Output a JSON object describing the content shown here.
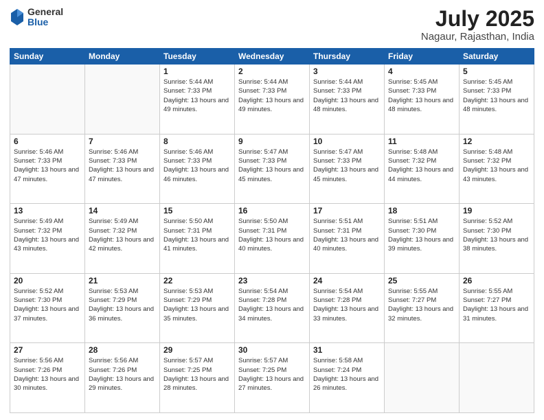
{
  "logo": {
    "general": "General",
    "blue": "Blue"
  },
  "title": "July 2025",
  "location": "Nagaur, Rajasthan, India",
  "days_of_week": [
    "Sunday",
    "Monday",
    "Tuesday",
    "Wednesday",
    "Thursday",
    "Friday",
    "Saturday"
  ],
  "weeks": [
    [
      {
        "day": "",
        "info": ""
      },
      {
        "day": "",
        "info": ""
      },
      {
        "day": "1",
        "info": "Sunrise: 5:44 AM\nSunset: 7:33 PM\nDaylight: 13 hours\nand 49 minutes."
      },
      {
        "day": "2",
        "info": "Sunrise: 5:44 AM\nSunset: 7:33 PM\nDaylight: 13 hours\nand 49 minutes."
      },
      {
        "day": "3",
        "info": "Sunrise: 5:44 AM\nSunset: 7:33 PM\nDaylight: 13 hours\nand 48 minutes."
      },
      {
        "day": "4",
        "info": "Sunrise: 5:45 AM\nSunset: 7:33 PM\nDaylight: 13 hours\nand 48 minutes."
      },
      {
        "day": "5",
        "info": "Sunrise: 5:45 AM\nSunset: 7:33 PM\nDaylight: 13 hours\nand 48 minutes."
      }
    ],
    [
      {
        "day": "6",
        "info": "Sunrise: 5:46 AM\nSunset: 7:33 PM\nDaylight: 13 hours\nand 47 minutes."
      },
      {
        "day": "7",
        "info": "Sunrise: 5:46 AM\nSunset: 7:33 PM\nDaylight: 13 hours\nand 47 minutes."
      },
      {
        "day": "8",
        "info": "Sunrise: 5:46 AM\nSunset: 7:33 PM\nDaylight: 13 hours\nand 46 minutes."
      },
      {
        "day": "9",
        "info": "Sunrise: 5:47 AM\nSunset: 7:33 PM\nDaylight: 13 hours\nand 45 minutes."
      },
      {
        "day": "10",
        "info": "Sunrise: 5:47 AM\nSunset: 7:33 PM\nDaylight: 13 hours\nand 45 minutes."
      },
      {
        "day": "11",
        "info": "Sunrise: 5:48 AM\nSunset: 7:32 PM\nDaylight: 13 hours\nand 44 minutes."
      },
      {
        "day": "12",
        "info": "Sunrise: 5:48 AM\nSunset: 7:32 PM\nDaylight: 13 hours\nand 43 minutes."
      }
    ],
    [
      {
        "day": "13",
        "info": "Sunrise: 5:49 AM\nSunset: 7:32 PM\nDaylight: 13 hours\nand 43 minutes."
      },
      {
        "day": "14",
        "info": "Sunrise: 5:49 AM\nSunset: 7:32 PM\nDaylight: 13 hours\nand 42 minutes."
      },
      {
        "day": "15",
        "info": "Sunrise: 5:50 AM\nSunset: 7:31 PM\nDaylight: 13 hours\nand 41 minutes."
      },
      {
        "day": "16",
        "info": "Sunrise: 5:50 AM\nSunset: 7:31 PM\nDaylight: 13 hours\nand 40 minutes."
      },
      {
        "day": "17",
        "info": "Sunrise: 5:51 AM\nSunset: 7:31 PM\nDaylight: 13 hours\nand 40 minutes."
      },
      {
        "day": "18",
        "info": "Sunrise: 5:51 AM\nSunset: 7:30 PM\nDaylight: 13 hours\nand 39 minutes."
      },
      {
        "day": "19",
        "info": "Sunrise: 5:52 AM\nSunset: 7:30 PM\nDaylight: 13 hours\nand 38 minutes."
      }
    ],
    [
      {
        "day": "20",
        "info": "Sunrise: 5:52 AM\nSunset: 7:30 PM\nDaylight: 13 hours\nand 37 minutes."
      },
      {
        "day": "21",
        "info": "Sunrise: 5:53 AM\nSunset: 7:29 PM\nDaylight: 13 hours\nand 36 minutes."
      },
      {
        "day": "22",
        "info": "Sunrise: 5:53 AM\nSunset: 7:29 PM\nDaylight: 13 hours\nand 35 minutes."
      },
      {
        "day": "23",
        "info": "Sunrise: 5:54 AM\nSunset: 7:28 PM\nDaylight: 13 hours\nand 34 minutes."
      },
      {
        "day": "24",
        "info": "Sunrise: 5:54 AM\nSunset: 7:28 PM\nDaylight: 13 hours\nand 33 minutes."
      },
      {
        "day": "25",
        "info": "Sunrise: 5:55 AM\nSunset: 7:27 PM\nDaylight: 13 hours\nand 32 minutes."
      },
      {
        "day": "26",
        "info": "Sunrise: 5:55 AM\nSunset: 7:27 PM\nDaylight: 13 hours\nand 31 minutes."
      }
    ],
    [
      {
        "day": "27",
        "info": "Sunrise: 5:56 AM\nSunset: 7:26 PM\nDaylight: 13 hours\nand 30 minutes."
      },
      {
        "day": "28",
        "info": "Sunrise: 5:56 AM\nSunset: 7:26 PM\nDaylight: 13 hours\nand 29 minutes."
      },
      {
        "day": "29",
        "info": "Sunrise: 5:57 AM\nSunset: 7:25 PM\nDaylight: 13 hours\nand 28 minutes."
      },
      {
        "day": "30",
        "info": "Sunrise: 5:57 AM\nSunset: 7:25 PM\nDaylight: 13 hours\nand 27 minutes."
      },
      {
        "day": "31",
        "info": "Sunrise: 5:58 AM\nSunset: 7:24 PM\nDaylight: 13 hours\nand 26 minutes."
      },
      {
        "day": "",
        "info": ""
      },
      {
        "day": "",
        "info": ""
      }
    ]
  ]
}
